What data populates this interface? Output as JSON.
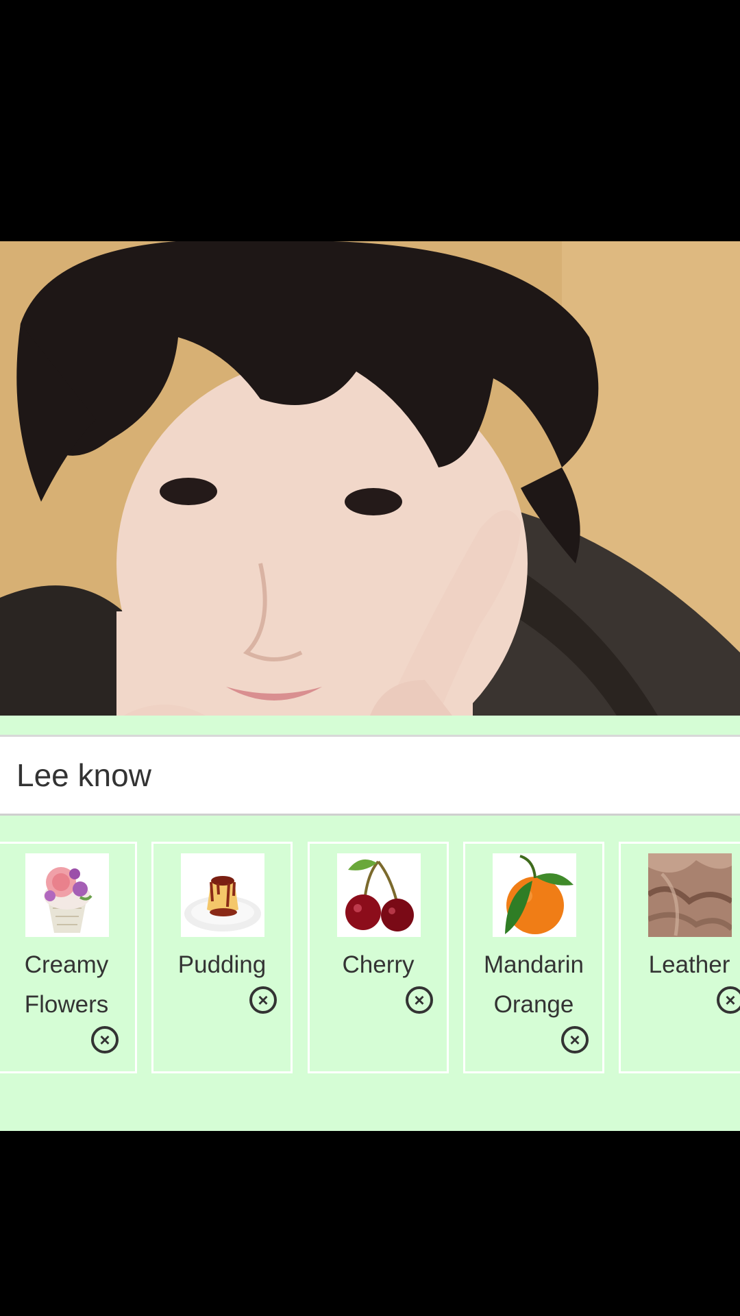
{
  "profile": {
    "photo_icon": "portrait-photo",
    "name": "Lee know"
  },
  "items": [
    {
      "label": "Creamy Flowers",
      "icon": "cupcake-flowers-thumbnail",
      "remove_icon": "close-circle-icon"
    },
    {
      "label": "Pudding",
      "icon": "pudding-thumbnail",
      "remove_icon": "close-circle-icon"
    },
    {
      "label": "Cherry",
      "icon": "cherry-thumbnail",
      "remove_icon": "close-circle-icon"
    },
    {
      "label": "Mandarin Orange",
      "icon": "mandarin-orange-thumbnail",
      "remove_icon": "close-circle-icon"
    },
    {
      "label": "Leather",
      "icon": "leather-thumbnail",
      "remove_icon": "close-circle-icon"
    }
  ],
  "colors": {
    "panel_background": "#d5fdd5",
    "name_bar_background": "#ffffff",
    "text": "#333333"
  }
}
